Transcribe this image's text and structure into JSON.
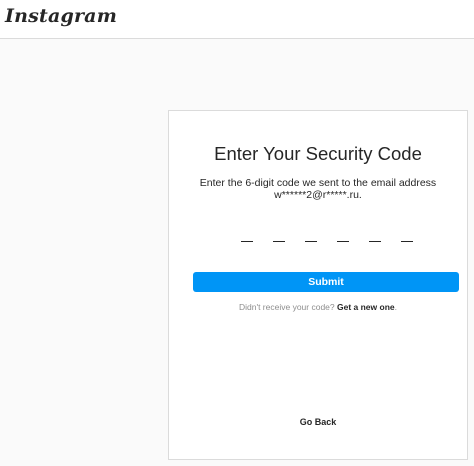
{
  "header": {
    "logo_text": "Instagram"
  },
  "card": {
    "title": "Enter Your Security Code",
    "description_line1": "Enter the 6-digit code we sent to the email address",
    "description_line2": "w******2@r*****.ru.",
    "code_slots": [
      "",
      "",
      "",
      "",
      "",
      ""
    ],
    "submit_label": "Submit",
    "resend_prompt": "Didn't receive your code?",
    "resend_link": "Get a new one",
    "resend_suffix": ".",
    "go_back_label": "Go Back"
  },
  "colors": {
    "background": "#fafafa",
    "card_background": "#ffffff",
    "border": "#dbdbdb",
    "primary_button": "#0095f6",
    "text_primary": "#262626",
    "text_secondary": "#8e8e8e"
  }
}
